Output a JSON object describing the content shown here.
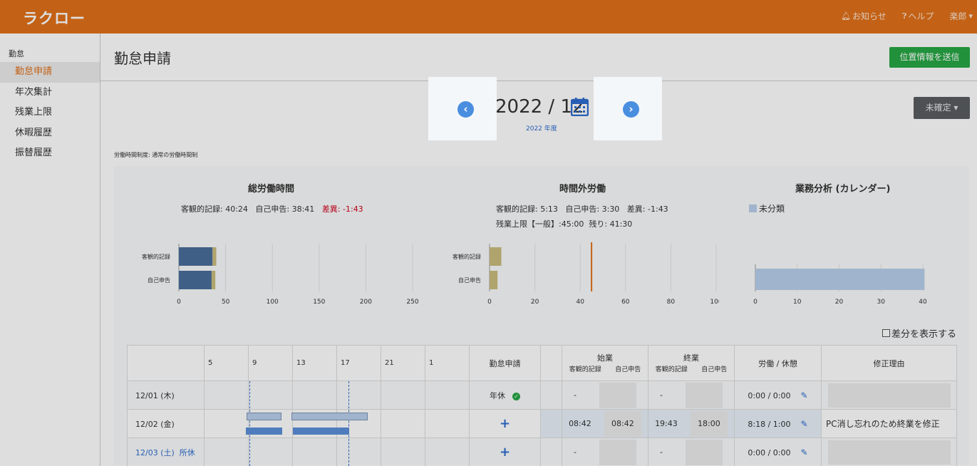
{
  "header": {
    "logo": "ラクロー",
    "notice": "お知らせ",
    "help": "ヘルプ",
    "user": "楽郎"
  },
  "sidebar": {
    "section": "勤怠",
    "items": [
      {
        "label": "勤怠申請",
        "active": true
      },
      {
        "label": "年次集計"
      },
      {
        "label": "残業上限"
      },
      {
        "label": "休暇履歴"
      },
      {
        "label": "振替履歴"
      }
    ]
  },
  "page": {
    "title": "勤怠申請",
    "send_location_button": "位置情報を送信",
    "period": "2022 / 12",
    "fiscal_year": "2022 年度",
    "status_button": "未確定",
    "work_system": "労働時間制度: 通常の労働時間制"
  },
  "summary": {
    "total": {
      "title": "総労働時間",
      "objective": "客観的記録: 40:24",
      "self_report": "自己申告: 38:41",
      "difference": "差異: -1:43"
    },
    "overtime": {
      "title": "時間外労働",
      "objective": "客観的記録: 5:13",
      "self_report": "自己申告: 3:30",
      "difference": "差異: -1:43",
      "limit": "残業上限【一般】:45:00",
      "remaining": "残り: 41:30"
    },
    "business": {
      "title": "業務分析 (カレンダー)",
      "legend": "未分類"
    }
  },
  "chart_data": [
    {
      "type": "bar",
      "orientation": "horizontal",
      "title": "総労働時間",
      "categories": [
        "客観的記録",
        "自己申告"
      ],
      "series": [
        {
          "values": [
            36,
            35
          ],
          "color": "#4a6e9a"
        },
        {
          "values": [
            4,
            4
          ],
          "color": "#c9bd7e"
        }
      ],
      "x_ticks": [
        "0",
        "50",
        "100",
        "150",
        "200",
        "250"
      ],
      "xlim": [
        0,
        250
      ]
    },
    {
      "type": "bar",
      "orientation": "horizontal",
      "title": "時間外労働",
      "categories": [
        "客観的記録",
        "自己申告"
      ],
      "series": [
        {
          "values": [
            5.2,
            3.5
          ],
          "color": "#c9bd7e"
        }
      ],
      "reference_line": 45,
      "reference_color": "#e0711a",
      "x_ticks": [
        "0",
        "20",
        "40",
        "60",
        "80",
        "100"
      ],
      "xlim": [
        0,
        100
      ]
    },
    {
      "type": "bar",
      "orientation": "horizontal",
      "title": "業務分析 (カレンダー)",
      "categories": [
        ""
      ],
      "series": [
        {
          "name": "未分類",
          "values": [
            40.4
          ],
          "color": "#b8d0ec"
        }
      ],
      "x_ticks": [
        "0",
        "10",
        "20",
        "30",
        "40"
      ],
      "xlim": [
        0,
        40
      ]
    }
  ],
  "toggle": {
    "show_diff": "差分を表示する"
  },
  "table": {
    "hours": [
      "5",
      "9",
      "13",
      "17",
      "21",
      "1"
    ],
    "col_request": "勤怠申請",
    "col_start": "始業",
    "col_end": "終業",
    "sub_objective": "客観的記録",
    "sub_self": "自己申告",
    "col_work": "労働 / 休憩",
    "col_reason": "修正理由",
    "rows": [
      {
        "date": "12/01 (木)",
        "request": "年休",
        "start_obj": "-",
        "start_self": "",
        "end_obj": "-",
        "end_self": "",
        "work": "0:00 / 0:00",
        "reason": ""
      },
      {
        "date": "12/02 (金)",
        "request": "+",
        "start_obj": "08:42",
        "start_self": "08:42",
        "end_obj": "19:43",
        "end_self": "18:00",
        "work": "8:18 / 1:00",
        "reason": "PC消し忘れのため終業を修正"
      },
      {
        "date": "12/03 (土)",
        "holiday": "所休",
        "request": "+",
        "start_obj": "-",
        "start_self": "",
        "end_obj": "-",
        "end_self": "",
        "work": "0:00 / 0:00",
        "reason": ""
      }
    ]
  }
}
